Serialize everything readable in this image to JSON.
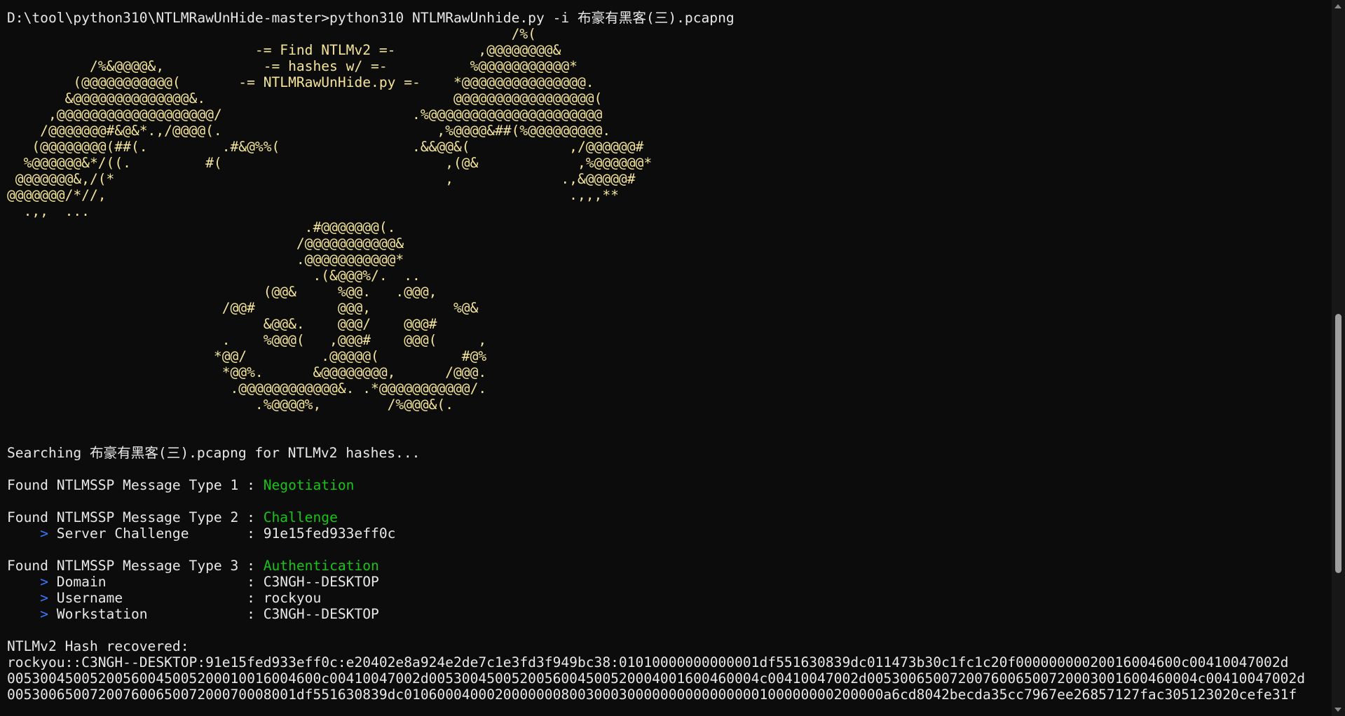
{
  "terminal": {
    "command_line": "D:\\tool\\python310\\NTLMRawUnHide-master>python310 NTLMRawUnhide.py -i 布豪有黑客(三).pcapng",
    "banner_lines": [
      "                                                             /%(",
      "                              -= Find NTLMv2 =-          ,@@@@@@@@&",
      "          /%&@@@@&,            -= hashes w/ =-          %@@@@@@@@@@@*",
      "        (@@@@@@@@@@@(       -= NTLMRawUnHide.py =-    *@@@@@@@@@@@@@@@.",
      "       &@@@@@@@@@@@@@@&.                              @@@@@@@@@@@@@@@@@(",
      "     ,@@@@@@@@@@@@@@@@@@@/                       .%@@@@@@@@@@@@@@@@@@@@@",
      "    /@@@@@@@#&@&*.,/@@@@(.                          ,%@@@@&##(%@@@@@@@@@.",
      "   (@@@@@@@@(##(.         .#&@%%(                .&&@@&(            ,/@@@@@@#",
      "  %@@@@@@&*/((.         #(                           ,(@&            ,%@@@@@@*",
      " @@@@@@@&,/(*                                        ,             .,&@@@@@#",
      "@@@@@@@/*//,                                                        .,,,**",
      "  .,,  ...",
      "                                    .#@@@@@@@(.",
      "                                   /@@@@@@@@@@@&",
      "                                   .@@@@@@@@@@@*",
      "                                     .(&@@@%/.  ..",
      "                               (@@&     %@@.   .@@@,",
      "                          /@@#          @@@,          %@&",
      "                               &@@&.    @@@/    @@@#",
      "                          .    %@@@(   ,@@@#    @@@(     ,",
      "                         *@@/         .@@@@@(          #@%",
      "                          *@@%.      &@@@@@@@@,      /@@@.",
      "                           .@@@@@@@@@@@@&. .*@@@@@@@@@@@/.",
      "                              .%@@@@%,        /%@@@&(."
    ],
    "searching_line": "Searching 布豪有黑客(三).pcapng for NTLMv2 hashes...",
    "type1": {
      "label": "Found NTLMSSP Message Type 1 : ",
      "value": "Negotiation"
    },
    "type2": {
      "label": "Found NTLMSSP Message Type 2 : ",
      "value": "Challenge",
      "server_challenge": {
        "marker": "    > ",
        "label": "Server Challenge       : ",
        "value": "91e15fed933eff0c"
      }
    },
    "type3": {
      "label": "Found NTLMSSP Message Type 3 : ",
      "value": "Authentication",
      "details": [
        {
          "marker": "    > ",
          "label": "Domain                 : ",
          "value": "C3NGH--DESKTOP"
        },
        {
          "marker": "    > ",
          "label": "Username               : ",
          "value": "rockyou"
        },
        {
          "marker": "    > ",
          "label": "Workstation            : ",
          "value": "C3NGH--DESKTOP"
        }
      ]
    },
    "hash_header": "NTLMv2 Hash recovered:",
    "hash_lines": [
      "rockyou::C3NGH--DESKTOP:91e15fed933eff0c:e20402e8a924e2de7c1e3fd3f949bc38:01010000000000001df551630839dc011473b30c1fc1c20f00000000020016004600c00410047002d",
      "00530045005200560045005200010016004600c00410047002d0053004500520056004500520004001600460004c00410047002d0053006500720076006500720003001600460004c00410047002d",
      "00530065007200760065007200070008001df551630839dc0106000400020000000800300030000000000000000100000000200000a6cd8042becda35cc7967ee26857127fac305123020cefe31f"
    ]
  }
}
